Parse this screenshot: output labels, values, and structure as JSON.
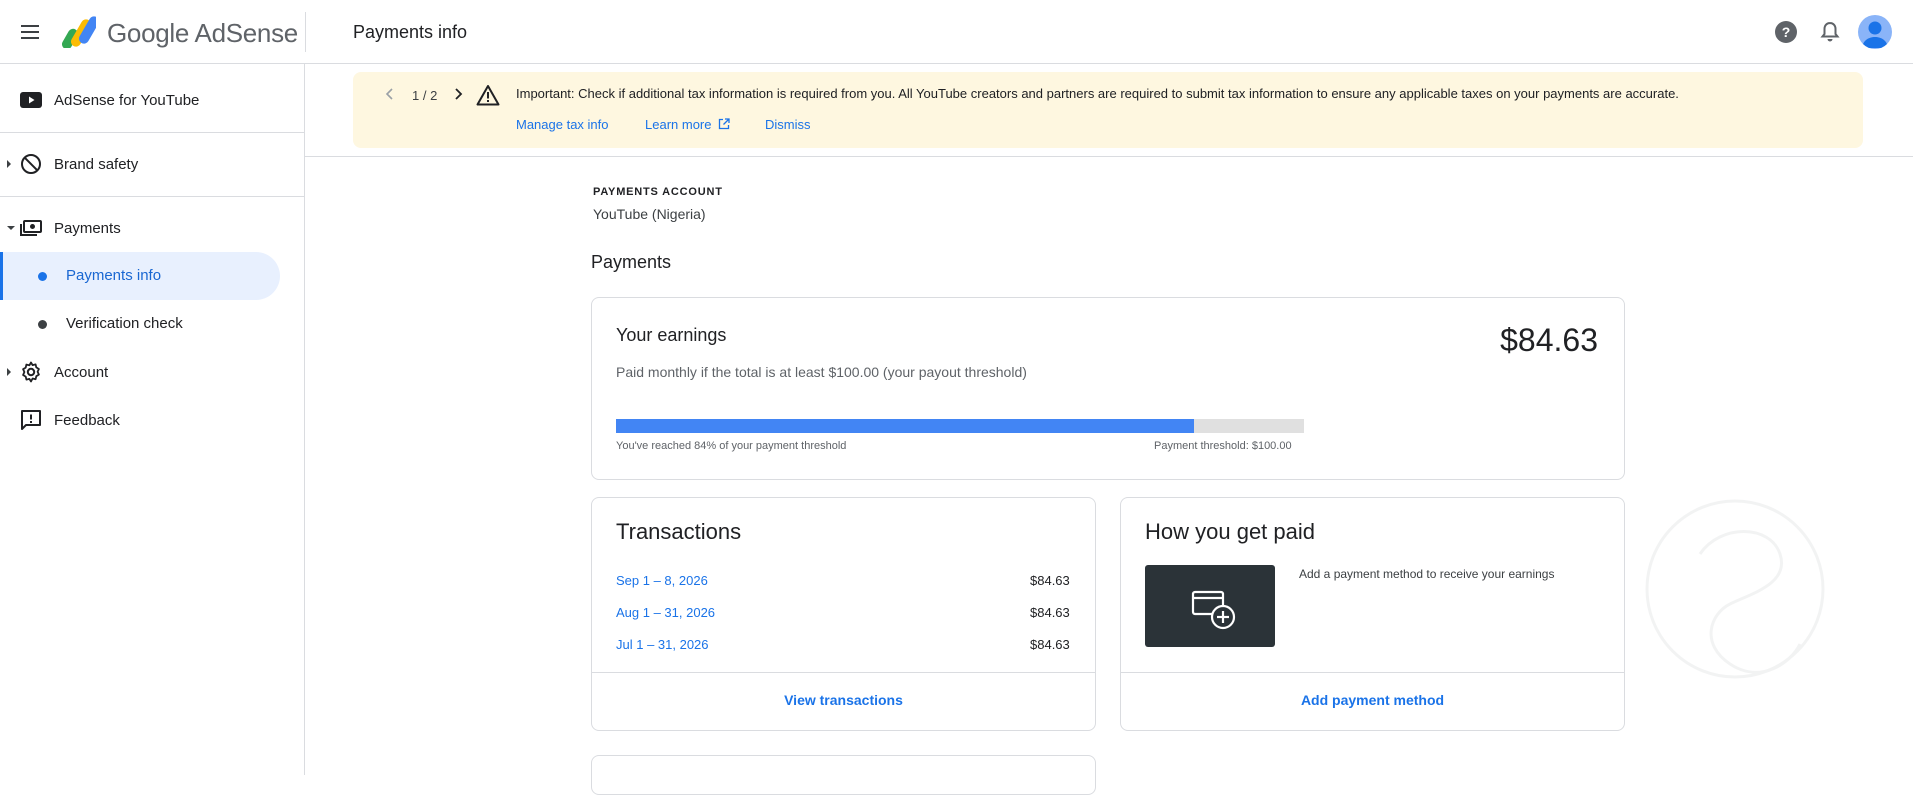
{
  "header": {
    "brand": "Google AdSense",
    "page_title": "Payments info"
  },
  "sidebar": {
    "items": [
      {
        "label": "AdSense for YouTube"
      },
      {
        "label": "Brand safety"
      },
      {
        "label": "Payments"
      },
      {
        "label": "Account"
      },
      {
        "label": "Feedback"
      }
    ],
    "payments_sub": [
      {
        "label": "Payments info",
        "active": true
      },
      {
        "label": "Verification check",
        "active": false
      }
    ]
  },
  "banner": {
    "counter": "1 / 2",
    "message": "Important: Check if additional tax information is required from you. All YouTube creators and partners are required to submit tax information to ensure any applicable taxes on your payments are accurate.",
    "links": [
      "Manage tax info",
      "Learn more",
      "Dismiss"
    ]
  },
  "account": {
    "label": "PAYMENTS ACCOUNT",
    "value": "YouTube (Nigeria)"
  },
  "payments_title": "Payments",
  "earnings": {
    "title": "Your earnings",
    "amount": "$84.63",
    "subtitle": "Paid monthly if the total is at least $100.00 (your payout threshold)",
    "progress_percent": 84,
    "progress_text": "You've reached 84% of your payment threshold",
    "threshold_text": "Payment threshold: $100.00"
  },
  "transactions": {
    "title": "Transactions",
    "rows": [
      {
        "date": "Sep 1 – 8, 2026",
        "amount": "$84.63"
      },
      {
        "date": "Aug 1 – 31, 2026",
        "amount": "$84.63"
      },
      {
        "date": "Jul 1 – 31, 2026",
        "amount": "$84.63"
      }
    ],
    "action": "View transactions"
  },
  "get_paid": {
    "title": "How you get paid",
    "text": "Add a payment method to receive your earnings",
    "action": "Add payment method"
  },
  "colors": {
    "accent": "#1a73e8",
    "progress": "#4285f4",
    "banner_bg": "#fef7e0"
  }
}
